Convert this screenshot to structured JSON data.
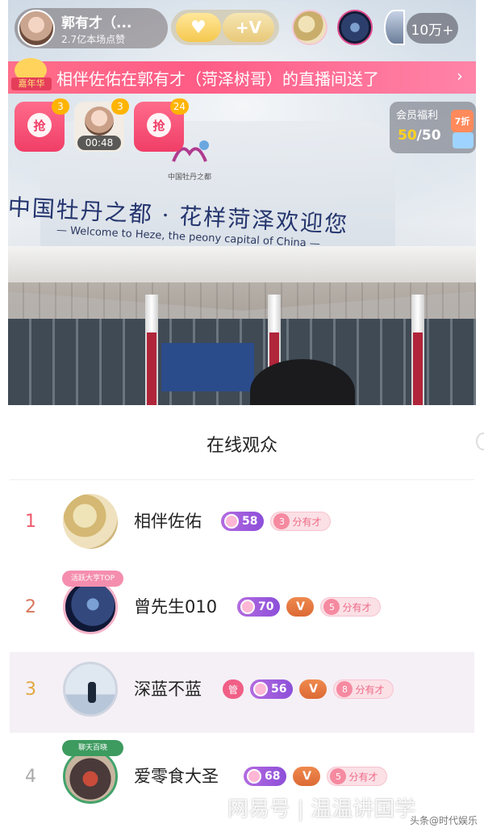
{
  "host": {
    "name": "郭有才（...",
    "likes": "2.7亿本场点赞",
    "plus_v_label": "+V"
  },
  "viewer_count": "10万+",
  "announcement": {
    "badge_label": "嘉年华",
    "text": "相伴佐佑在郭有才（菏泽树哥）的直播间送了"
  },
  "packets": [
    {
      "count": "3"
    },
    {
      "count": "3",
      "timer": "00:48"
    },
    {
      "count": "24"
    }
  ],
  "member": {
    "title": "会员福利",
    "value_current": "50",
    "value_total": "/50",
    "discount": "7折"
  },
  "scene": {
    "sign_zh": "中国牡丹之都 · 花样菏泽欢迎您",
    "sign_en": "— Welcome to Heze, the peony capital of China —",
    "sign_small": "中国牡丹之都"
  },
  "panel": {
    "title": "在线观众",
    "rows": [
      {
        "rank": "1",
        "name": "相伴佐佑",
        "level": "58",
        "fan_level": "3",
        "fan_label": "分有才"
      },
      {
        "rank": "2",
        "name": "曾先生010",
        "level": "70",
        "vip": "V",
        "fan_level": "5",
        "fan_label": "分有才",
        "crown": "活跃大亨TOP"
      },
      {
        "rank": "3",
        "name": "深蓝不蓝",
        "admin": "管",
        "level": "56",
        "vip": "V",
        "fan_level": "8",
        "fan_label": "分有才"
      },
      {
        "rank": "4",
        "name": "爱零食大圣",
        "level": "68",
        "vip": "V",
        "fan_level": "5",
        "fan_label": "分有才",
        "crown": "聊天百晓"
      }
    ]
  },
  "watermark": {
    "main": "网易号 | 温温讲国学",
    "sub": "头条@时代娱乐"
  },
  "colors": {
    "accent_pink": "#ff5c86",
    "level_purple": "#8c4fd9",
    "vip_orange": "#dc6a35"
  }
}
